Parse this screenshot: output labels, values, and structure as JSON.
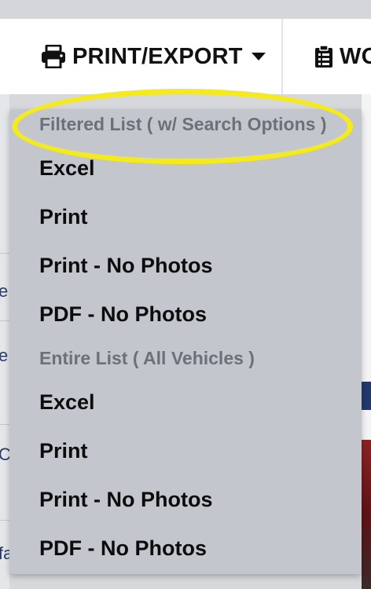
{
  "toolbar": {
    "print_label": "PRINT/EXPORT",
    "work_label": "WO"
  },
  "menu": {
    "filtered_header": "Filtered List ( w/ Search Options )",
    "filtered_items": [
      "Excel",
      "Print",
      "Print - No Photos",
      "PDF - No Photos"
    ],
    "entire_header": "Entire List ( All Vehicles )",
    "entire_items": [
      "Excel",
      "Print",
      "Print - No Photos",
      "PDF - No Photos"
    ]
  },
  "background": {
    "left_letters": [
      "e",
      "e",
      "C",
      "fa"
    ]
  },
  "colors": {
    "highlight": "#f4ea1e",
    "menu_bg": "#c3c7cd",
    "header_text": "#6c7078",
    "accent_blue": "#23396a"
  },
  "icons": {
    "print": "printer-icon",
    "caret": "caret-down-icon",
    "work": "clipboard-list-icon"
  }
}
